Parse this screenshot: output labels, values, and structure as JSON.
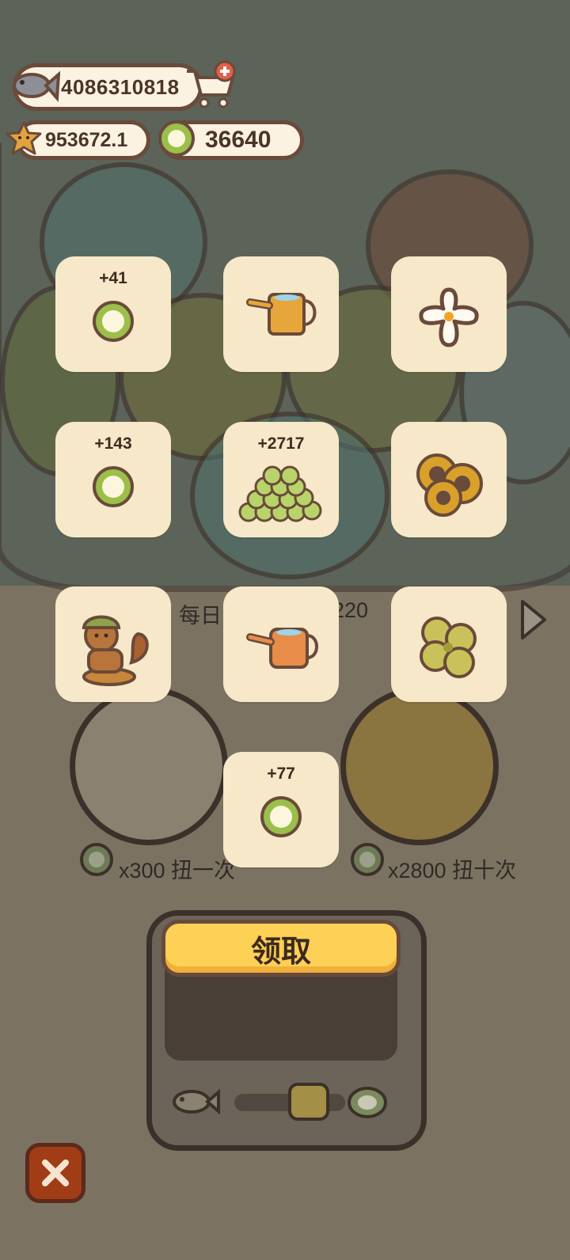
{
  "currencies": {
    "fish": "4086310818",
    "star": "953672.1",
    "coin": "36640"
  },
  "machine": {
    "daily_label_left": "每日",
    "daily_label_right": "220",
    "spin_one": "x300 扭一次",
    "spin_ten": "x2800 扭十次"
  },
  "rewards": [
    {
      "amount": "+41",
      "item": "coin-icon"
    },
    {
      "amount": "",
      "item": "watering-can-icon"
    },
    {
      "amount": "",
      "item": "flower-icon"
    },
    {
      "amount": "+143",
      "item": "coin-icon"
    },
    {
      "amount": "+2717",
      "item": "coin-pile-icon"
    },
    {
      "amount": "",
      "item": "sunflower-icon"
    },
    {
      "amount": "",
      "item": "squirrel-character-icon"
    },
    {
      "amount": "",
      "item": "watering-can-icon"
    },
    {
      "amount": "",
      "item": "clover-icon"
    },
    {
      "amount": "+77",
      "item": "coin-icon"
    }
  ],
  "claim_label": "领取",
  "colors": {
    "tile": "#f6e8c8",
    "button": "#fdd056",
    "close": "#a03d16"
  }
}
